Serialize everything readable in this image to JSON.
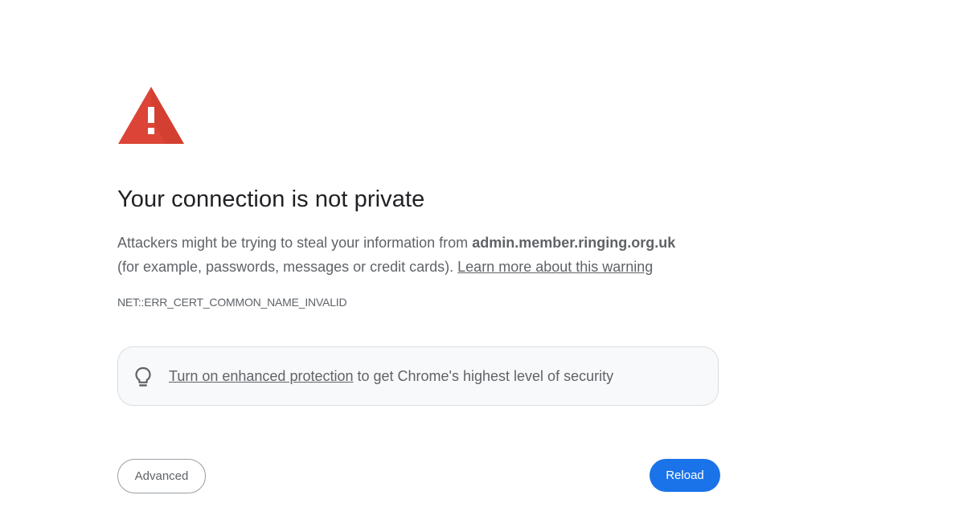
{
  "interstitial": {
    "warning_icon": "warning-triangle-icon",
    "warning_color": "#db4437",
    "heading": "Your connection is not private",
    "explanation": {
      "before_host": "Attackers might be trying to steal your information from ",
      "host": "admin.member.ringing.org.uk",
      "after_host": " (for example, passwords, messages or credit cards). ",
      "learn_more_link": "Learn more about this warning"
    },
    "error_code": "NET::ERR_CERT_COMMON_NAME_INVALID",
    "enhanced_protection": {
      "icon": "lightbulb-icon",
      "link_text": "Turn on enhanced protection",
      "suffix": " to get Chrome's highest level of security"
    },
    "buttons": {
      "advanced_label": "Advanced",
      "reload_label": "Reload",
      "reload_color": "#1a73e8"
    }
  }
}
